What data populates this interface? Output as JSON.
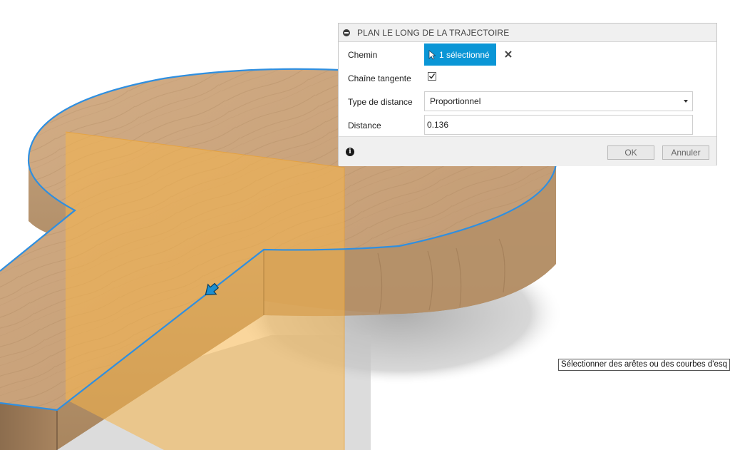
{
  "dialog": {
    "title": "PLAN LE LONG DE LA TRAJECTOIRE",
    "path_label": "Chemin",
    "path_selection": "1 sélectionné",
    "tangent_chain_label": "Chaîne tangente",
    "tangent_chain_checked": true,
    "distance_type_label": "Type de distance",
    "distance_type_value": "Proportionnel",
    "distance_label": "Distance",
    "distance_value": "0.136",
    "ok_label": "OK",
    "cancel_label": "Annuler"
  },
  "tooltip": {
    "text": "Sélectionner des arêtes ou des courbes d'esq"
  },
  "colors": {
    "accent": "#0a96d6",
    "wood": "#c9a47a",
    "plane": "#f5b54a",
    "edge_highlight": "#2f8fe0"
  },
  "icons": {
    "collapse": "collapse-icon",
    "cursor": "arrow-cursor-icon",
    "clear": "close-icon",
    "info": "info-icon",
    "plane_manipulator": "arrow-manipulator-icon"
  }
}
